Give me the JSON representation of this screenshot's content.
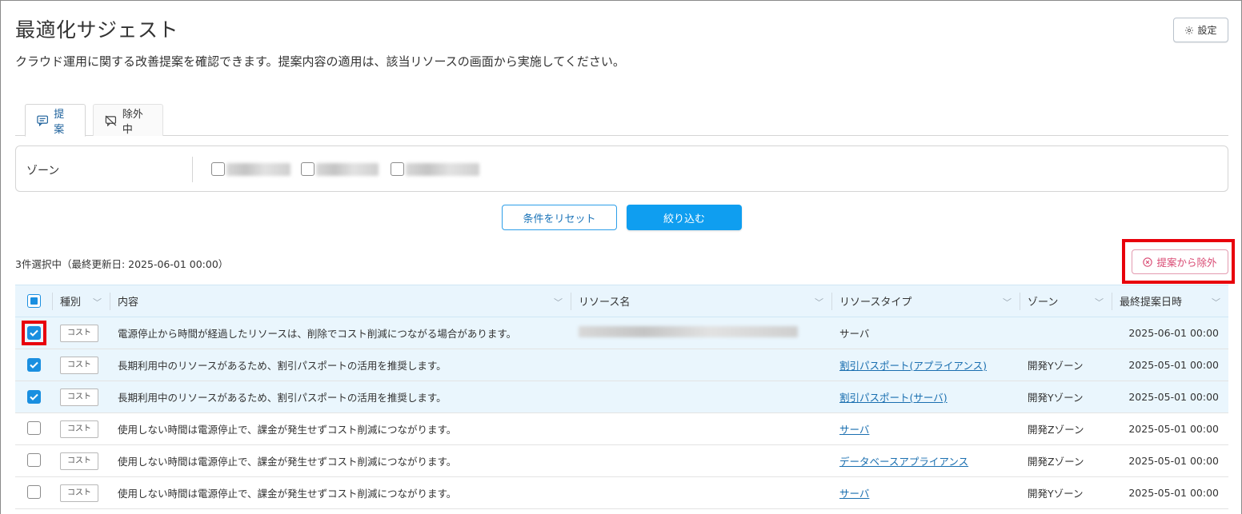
{
  "page": {
    "title": "最適化サジェスト",
    "subtitle": "クラウド運用に関する改善提案を確認できます。提案内容の適用は、該当リソースの画面から実施してください。",
    "settings_label": "設定"
  },
  "tabs": [
    {
      "label": "提案",
      "active": true,
      "icon": "chat-icon"
    },
    {
      "label": "除外中",
      "active": false,
      "icon": "excluded-icon"
    }
  ],
  "filter": {
    "zone_label": "ゾーン",
    "reset_label": "条件をリセット",
    "apply_label": "絞り込む"
  },
  "selection_info": "3件選択中（最終更新日: 2025-06-01 00:00）",
  "exclude_label": "提案から除外",
  "table": {
    "headers": {
      "type": "種別",
      "content": "内容",
      "resource_name": "リソース名",
      "resource_type": "リソースタイプ",
      "zone": "ゾーン",
      "last_date": "最終提案日時"
    },
    "rows": [
      {
        "checked": true,
        "type": "コスト",
        "content": "電源停止から時間が経過したリソースは、削除でコスト削減につながる場合があります。",
        "resource_type": "サーバ",
        "resource_type_link": false,
        "zone": "",
        "date": "2025-06-01 00:00"
      },
      {
        "checked": true,
        "type": "コスト",
        "content": "長期利用中のリソースがあるため、割引パスポートの活用を推奨します。",
        "resource_type": "割引パスポート(アプライアンス)",
        "resource_type_link": true,
        "zone": "開発Yゾーン",
        "date": "2025-05-01 00:00"
      },
      {
        "checked": true,
        "type": "コスト",
        "content": "長期利用中のリソースがあるため、割引パスポートの活用を推奨します。",
        "resource_type": "割引パスポート(サーバ)",
        "resource_type_link": true,
        "zone": "開発Yゾーン",
        "date": "2025-05-01 00:00"
      },
      {
        "checked": false,
        "type": "コスト",
        "content": "使用しない時間は電源停止で、課金が発生せずコスト削減につながります。",
        "resource_type": "サーバ",
        "resource_type_link": true,
        "zone": "開発Zゾーン",
        "date": "2025-05-01 00:00"
      },
      {
        "checked": false,
        "type": "コスト",
        "content": "使用しない時間は電源停止で、課金が発生せずコスト削減につながります。",
        "resource_type": "データベースアプライアンス",
        "resource_type_link": true,
        "zone": "開発Zゾーン",
        "date": "2025-05-01 00:00"
      },
      {
        "checked": false,
        "type": "コスト",
        "content": "使用しない時間は電源停止で、課金が発生せずコスト削減につながります。",
        "resource_type": "サーバ",
        "resource_type_link": true,
        "zone": "開発Yゾーン",
        "date": "2025-05-01 00:00"
      }
    ]
  },
  "colors": {
    "accent": "#0f9ef0",
    "highlight": "#e8000b",
    "link": "#1a6fb0",
    "selected_row": "#eaf6fd"
  }
}
